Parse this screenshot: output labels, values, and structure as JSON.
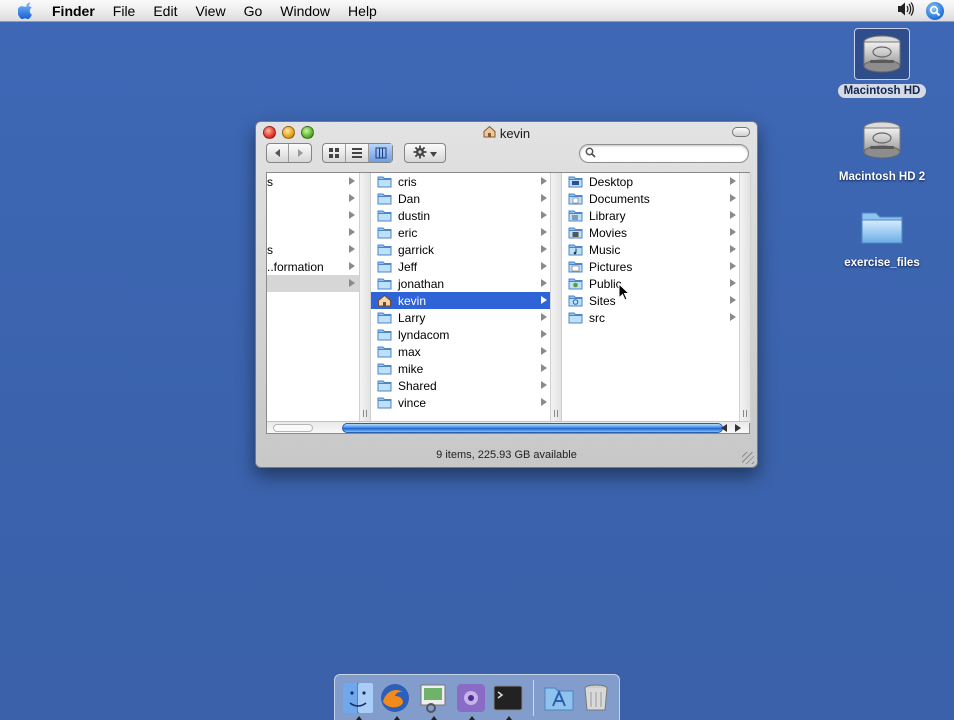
{
  "menubar": {
    "apple": "apple-icon",
    "items": [
      {
        "label": "Finder"
      },
      {
        "label": "File"
      },
      {
        "label": "Edit"
      },
      {
        "label": "View"
      },
      {
        "label": "Go"
      },
      {
        "label": "Window"
      },
      {
        "label": "Help"
      }
    ],
    "right_icons": [
      "volume-icon",
      "spotlight-icon"
    ]
  },
  "desktop_icons": [
    {
      "label": "Macintosh HD",
      "icon": "hard-drive-icon",
      "selected": true
    },
    {
      "label": "Macintosh HD 2",
      "icon": "hard-drive-icon",
      "selected": false
    },
    {
      "label": "exercise_files",
      "icon": "folder-icon",
      "selected": false
    }
  ],
  "window": {
    "title": "kevin",
    "title_icon": "home-icon",
    "search": {
      "value": "",
      "placeholder": ""
    },
    "columns": [
      {
        "items": [
          {
            "label": "s",
            "arrow": true
          },
          {
            "label": "",
            "arrow": true
          },
          {
            "label": "",
            "arrow": true
          },
          {
            "label": "",
            "arrow": true
          },
          {
            "label": "s",
            "arrow": true
          },
          {
            "label": "..formation",
            "arrow": true
          },
          {
            "label": "",
            "arrow": true,
            "selected": "inactive"
          }
        ]
      },
      {
        "items": [
          {
            "label": "cris",
            "icon": "folder-icon"
          },
          {
            "label": "Dan",
            "icon": "folder-icon"
          },
          {
            "label": "dustin",
            "icon": "folder-icon"
          },
          {
            "label": "eric",
            "icon": "folder-icon"
          },
          {
            "label": "garrick",
            "icon": "folder-icon"
          },
          {
            "label": "Jeff",
            "icon": "folder-icon"
          },
          {
            "label": "jonathan",
            "icon": "folder-icon"
          },
          {
            "label": "kevin",
            "icon": "home-icon",
            "selected": "active"
          },
          {
            "label": "Larry",
            "icon": "folder-icon"
          },
          {
            "label": "lyndacom",
            "icon": "folder-icon"
          },
          {
            "label": "max",
            "icon": "folder-icon"
          },
          {
            "label": "mike",
            "icon": "folder-icon"
          },
          {
            "label": "Shared",
            "icon": "folder-icon"
          },
          {
            "label": "vince",
            "icon": "folder-icon"
          }
        ]
      },
      {
        "items": [
          {
            "label": "Desktop",
            "icon": "desktop-folder-icon"
          },
          {
            "label": "Documents",
            "icon": "documents-folder-icon"
          },
          {
            "label": "Library",
            "icon": "library-folder-icon"
          },
          {
            "label": "Movies",
            "icon": "movies-folder-icon"
          },
          {
            "label": "Music",
            "icon": "music-folder-icon"
          },
          {
            "label": "Pictures",
            "icon": "pictures-folder-icon"
          },
          {
            "label": "Public",
            "icon": "public-folder-icon"
          },
          {
            "label": "Sites",
            "icon": "sites-folder-icon"
          },
          {
            "label": "src",
            "icon": "folder-icon"
          }
        ]
      }
    ],
    "status": "9 items, 225.93 GB available"
  },
  "dock": {
    "apps": [
      "finder-icon",
      "firefox-icon",
      "preview-icon",
      "photoshop-icon",
      "terminal-icon"
    ],
    "right": [
      "applications-folder-icon",
      "trash-icon"
    ]
  },
  "colors": {
    "desktop": "#3e68b5",
    "selection": "#2f63d8",
    "folder": "#8fc3ee"
  }
}
